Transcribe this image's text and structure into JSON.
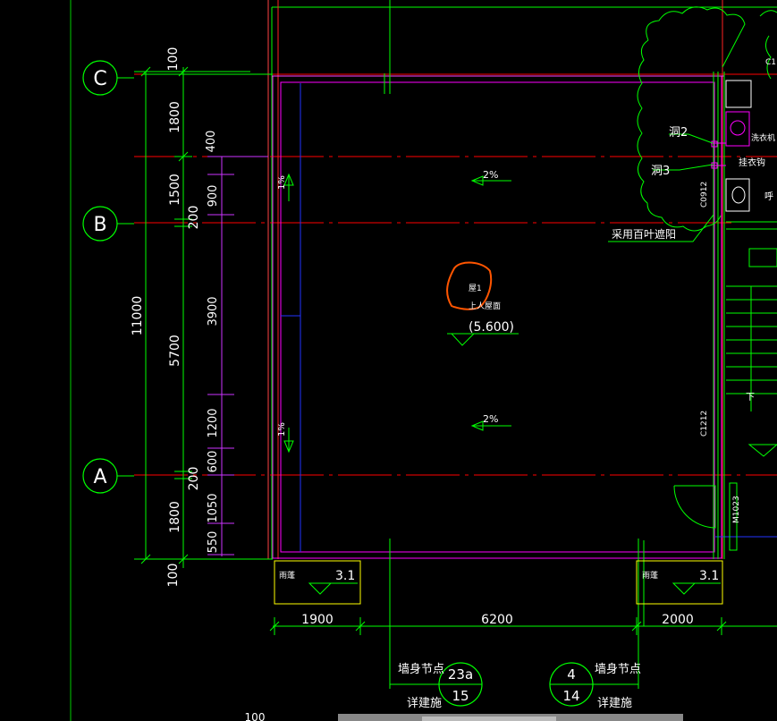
{
  "grid_axes": {
    "c": "C",
    "b": "B",
    "a": "A"
  },
  "dims_outer_vertical": {
    "total": "11000",
    "top_ext": "100",
    "c_to_b": "1800",
    "seg_1500": "1500",
    "b_gap": "200",
    "mid": "5700",
    "a_gap": "200",
    "a_to_bottom": "1800",
    "bottom_ext": "100"
  },
  "dims_inner_vertical": {
    "d400": "400",
    "d900": "900",
    "d3900": "3900",
    "d1200": "1200",
    "d600": "600",
    "d1050": "1050",
    "d550": "550"
  },
  "dims_horizontal": {
    "left": "1900",
    "mid": "6200",
    "right": "2000",
    "bottom_partial": "100"
  },
  "slope_labels": {
    "top": "2%",
    "bottom": "2%",
    "left_top": "1%",
    "left_bottom": "1%"
  },
  "roof": {
    "name": "屋1",
    "type": "上人屋面",
    "elevation": "(5.600)"
  },
  "canopy": {
    "left_label": "雨蓬",
    "left_elev": "3.1",
    "right_label": "雨蓬",
    "right_elev": "3.1"
  },
  "details": [
    {
      "label": "墙身节点",
      "num": "23a",
      "sheet": "15",
      "sub": "详建施"
    },
    {
      "label": "墙身节点",
      "num": "4",
      "sheet": "14",
      "sub": "详建施"
    }
  ],
  "right_annotations": {
    "hole2": "洞2",
    "hole3": "洞3",
    "louver": "采用百叶遮阳",
    "c0912": "C0912",
    "c1212": "C1212",
    "m1023": "M1023",
    "hook": "挂衣钩",
    "washer": "洗衣机",
    "c1": "C1",
    "down": "下",
    "call": "呼"
  },
  "colors": {
    "dim": "#00ff00",
    "axis": "#ff0000",
    "wall": "#ff00ff",
    "white": "#ffffff",
    "blue": "#0000ff",
    "highlight": "#ff5500",
    "yellow": "#ffff00"
  }
}
